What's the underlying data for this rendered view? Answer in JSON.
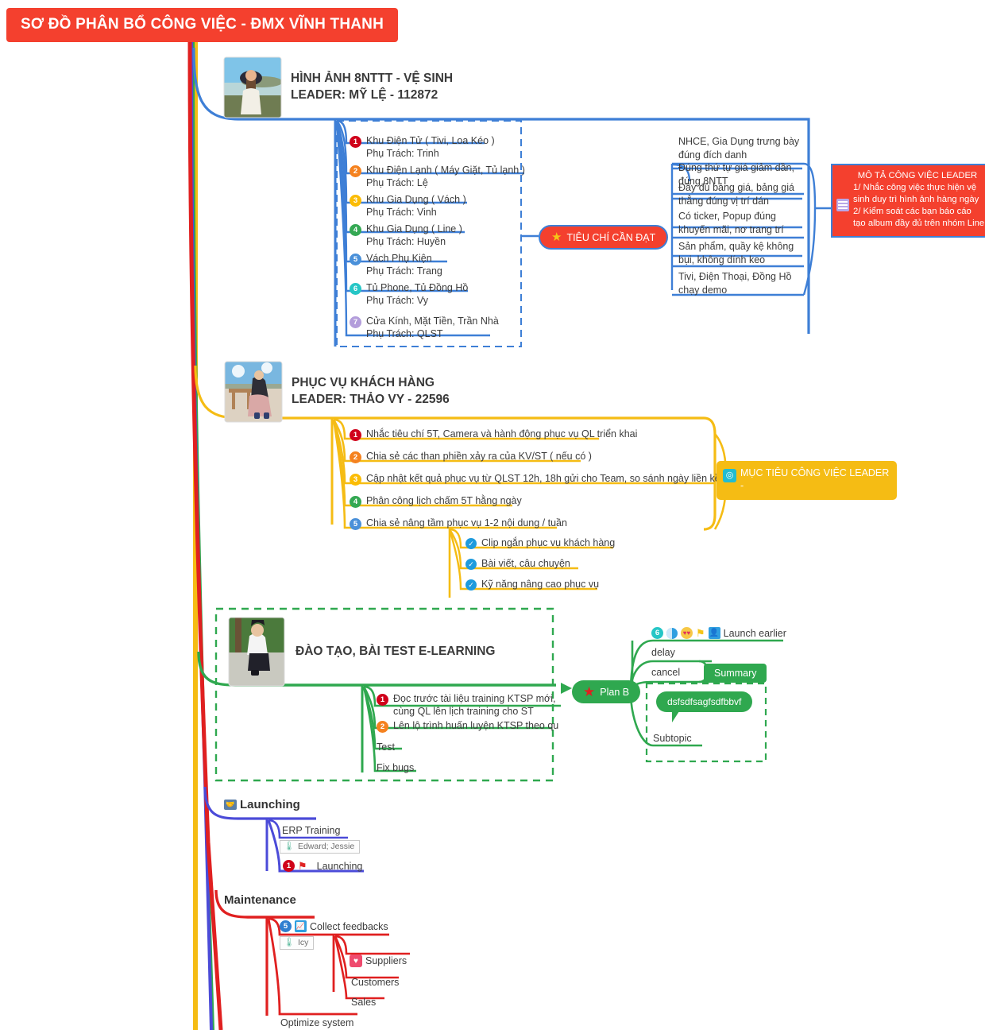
{
  "title": "SƠ ĐỒ PHÂN BỔ CÔNG VIỆC - ĐMX VĨNH THANH",
  "colors": {
    "title_bg": "#f4402e",
    "branch1": "#3e7fd6",
    "branch2": "#f5bc14",
    "branch3": "#2fa84f",
    "branch4": "#4b4bd8",
    "branch5": "#e02020",
    "num1": "#d0021b",
    "num2": "#f5821f",
    "num3": "#fbbc05",
    "num4": "#34a853",
    "num5": "#4a90d9",
    "num6": "#26c6c6",
    "num7": "#b39ddb"
  },
  "branch1": {
    "header_line1": "HÌNH ẢNH 8NTTT - VỆ SINH",
    "header_line2": "LEADER: MỸ LỆ - 112872",
    "thumb_name": "photo-woman-hat-mountain",
    "items": [
      {
        "n": "1",
        "line1": "Khu Điện Tử ( Tivi, Loa Kéo )",
        "line2": "Phụ Trách: Trinh"
      },
      {
        "n": "2",
        "line1": "Khu Điện Lạnh ( Máy Giặt, Tủ lạnh )",
        "line2": "Phụ Trách: Lệ"
      },
      {
        "n": "3",
        "line1": "Khu Gia Dụng ( Vách )",
        "line2": "Phụ Trách: Vinh"
      },
      {
        "n": "4",
        "line1": "Khu Gia Dụng ( Line )",
        "line2": "Phụ Trách: Huyền"
      },
      {
        "n": "5",
        "line1": "Vách Phụ Kiện",
        "line2": "Phụ Trách: Trang"
      },
      {
        "n": "6",
        "line1": "Tủ Phone, Tủ Đồng Hồ",
        "line2": "Phụ Trách: Vy"
      },
      {
        "n": "7",
        "line1": "Cửa Kính, Mặt Tiền, Trần Nhà",
        "line2": "Phụ Trách: QLST"
      }
    ],
    "callout_label": "TIÊU CHÍ CẦN ĐẠT",
    "callout_icon": "star-icon",
    "criteria": [
      {
        "lines": [
          "NHCE, Gia Dụng trưng bày",
          "đúng đích danh",
          "Đúng thứ tự giá giảm dần,",
          "đúng 8NTT"
        ]
      },
      {
        "lines": [
          "Đầy đủ bảng giá, bảng giá",
          "thẳng đúng vị trí dán"
        ]
      },
      {
        "lines": [
          "Có ticker, Popup đúng",
          "khuyến mãi, nơ trang trí"
        ]
      },
      {
        "lines": [
          "Sản phẩm, quầy kệ không",
          "bụi, không dính keo"
        ]
      },
      {
        "lines": [
          "Tivi, Điện Thoại, Đồng Hồ",
          "chạy demo"
        ]
      }
    ],
    "leader_box": {
      "icon": "note-icon",
      "heading": "MÔ TẢ CÔNG VIỆC LEADER",
      "lines": [
        "1/ Nhắc công việc thực hiện vệ",
        "sinh duy trì hình ảnh hàng ngày",
        "2/ Kiểm soát các bạn báo cáo",
        "tạo album đầy đủ trên nhóm Line"
      ]
    }
  },
  "branch2": {
    "header_line1": "PHỤC VỤ KHÁCH HÀNG",
    "header_line2": "LEADER: THẢO VY - 22596",
    "thumb_name": "photo-woman-beach-table",
    "items": [
      {
        "n": "1",
        "text": "Nhắc tiêu chí 5T, Camera và hành động phục vụ QL triển khai"
      },
      {
        "n": "2",
        "text": "Chia sẻ các than phiền xảy ra của KV/ST ( nếu có )"
      },
      {
        "n": "3",
        "text": "Cập nhật kết quả phục vụ từ QLST 12h, 18h gửi cho Team, so sánh ngày liền kề"
      },
      {
        "n": "4",
        "text": "Phân công lịch chấm 5T hằng ngày"
      },
      {
        "n": "5",
        "text": "Chia sẻ nâng tầm phục vụ 1-2 nội dung / tuần"
      }
    ],
    "subitems": [
      {
        "text": "Clip ngắn phục vụ khách hàng"
      },
      {
        "text": "Bài viết, câu chuyện"
      },
      {
        "text": "Kỹ năng nâng cao phục vụ"
      }
    ],
    "goal_box": {
      "icon": "target-icon",
      "heading": "MỤC TIÊU CÔNG VIỆC LEADER",
      "sub": "-"
    }
  },
  "branch3": {
    "header": "ĐÀO TẠO, BÀI TEST E-LEARNING",
    "thumb_name": "photo-man-squatting-trees",
    "items": [
      {
        "n": "1",
        "line1": "Đọc trước tài liệu training KTSP mới,",
        "line2": "cùng QL lên lịch training cho ST"
      },
      {
        "n": "2",
        "line1": "Lên lộ trình huấn luyện KTSP theo qu",
        "line2": ""
      },
      {
        "n": "",
        "line1": "Test",
        "line2": ""
      },
      {
        "n": "",
        "line1": "Fix bugs",
        "line2": ""
      }
    ],
    "plan_b": {
      "label": "Plan B",
      "icon": "red-star-icon",
      "children": [
        {
          "label": "Launch earlier",
          "icons": [
            "six-badge-icon",
            "half-moon-icon",
            "smiley-hearts-icon",
            "yellow-flag-icon",
            "person-icon"
          ]
        },
        {
          "label": "delay",
          "icons": []
        },
        {
          "label": "cancel",
          "icons": []
        },
        {
          "label": "Subtopic",
          "icons": []
        }
      ],
      "summary_label": "Summary",
      "bubble_label": "dsfsdfsagfsdfbbvf"
    }
  },
  "branch4": {
    "header": "Launching",
    "header_icon": "handshake-icon",
    "items": [
      {
        "label": "ERP Training",
        "tag": "Edward; Jessie",
        "tag_icon": "thermometer-icon"
      },
      {
        "label": "Launching",
        "n": "1",
        "icon": "red-flag-icon"
      }
    ]
  },
  "branch5": {
    "header": "Maintenance",
    "items": [
      {
        "label": "Collect feedbacks",
        "n": "5",
        "icon": "chart-icon",
        "tag": "Icy",
        "tag_icon": "thermometer-icon"
      },
      {
        "label": "Suppliers",
        "icon": "heart-icon"
      },
      {
        "label": "Customers"
      },
      {
        "label": "Sales"
      },
      {
        "label": "Optimize system"
      }
    ]
  }
}
